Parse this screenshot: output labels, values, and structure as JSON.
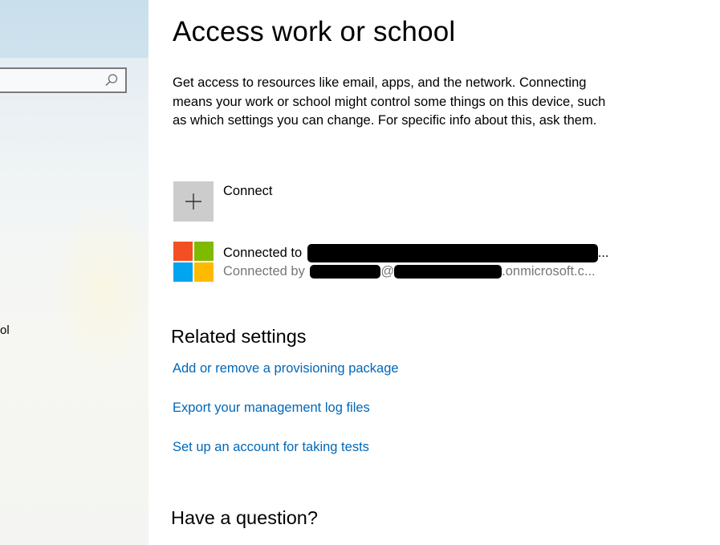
{
  "nav": {
    "search": {
      "placeholder": "",
      "icon": "search-icon"
    },
    "partial_item_label": "ol"
  },
  "main": {
    "title": "Access work or school",
    "description": "Get access to resources like email, apps, and the network. Connecting means your work or school might control some things on this device, such as which settings you can change. For specific info about this, ask them.",
    "connect": {
      "label": "Connect",
      "icon": "plus-icon"
    },
    "account": {
      "line1_prefix": "Connected to",
      "line1_suffix": "...",
      "line2_prefix": "Connected by",
      "line2_at": "@",
      "line2_domain": ".onmicrosoft.c...",
      "logo_colors": [
        "#f25022",
        "#7fba00",
        "#00a4ef",
        "#ffb900"
      ]
    },
    "related_settings": {
      "heading": "Related settings",
      "links": [
        "Add or remove a provisioning package",
        "Export your management log files",
        "Set up an account for taking tests"
      ]
    },
    "have_a_question": {
      "heading": "Have a question?"
    }
  },
  "colors": {
    "link": "#0067b8",
    "tile": "#cccccc",
    "secondary_text": "#767676"
  }
}
